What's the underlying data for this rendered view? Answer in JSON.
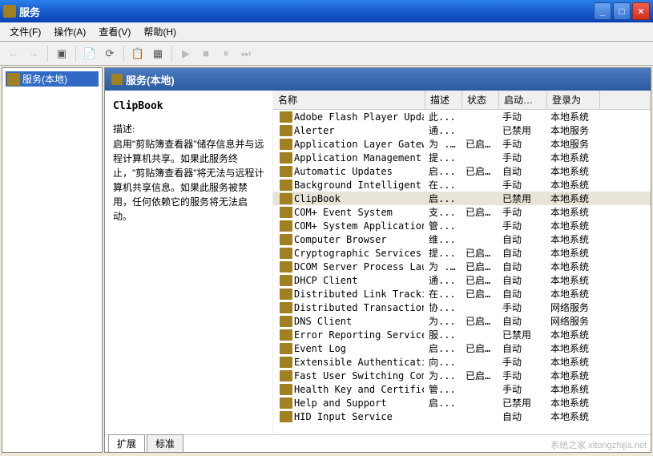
{
  "window": {
    "title": "服务"
  },
  "menu": {
    "file": "文件(F)",
    "action": "操作(A)",
    "view": "查看(V)",
    "help": "帮助(H)"
  },
  "tree": {
    "root": "服务(本地)"
  },
  "panel": {
    "header": "服务(本地)"
  },
  "detail": {
    "name": "ClipBook",
    "desc_label": "描述:",
    "desc_text": "启用\"剪贴簿查看器\"储存信息并与远程计算机共享。如果此服务终止，\"剪贴簿查看器\"将无法与远程计算机共享信息。如果此服务被禁用，任何依赖它的服务将无法启动。"
  },
  "columns": {
    "name": "名称",
    "desc": "描述",
    "state": "状态",
    "start": "启动类型",
    "logon": "登录为"
  },
  "tabs": {
    "ext": "扩展",
    "std": "标准"
  },
  "services": [
    {
      "name": "Adobe Flash Player Updat...",
      "desc": "此...",
      "state": "",
      "start": "手动",
      "logon": "本地系统"
    },
    {
      "name": "Alerter",
      "desc": "通...",
      "state": "",
      "start": "已禁用",
      "logon": "本地服务"
    },
    {
      "name": "Application Layer Gatewa...",
      "desc": "为 ...",
      "state": "已启动",
      "start": "手动",
      "logon": "本地服务"
    },
    {
      "name": "Application Management",
      "desc": "提...",
      "state": "",
      "start": "手动",
      "logon": "本地系统"
    },
    {
      "name": "Automatic Updates",
      "desc": "启...",
      "state": "已启动",
      "start": "自动",
      "logon": "本地系统"
    },
    {
      "name": "Background Intelligent T...",
      "desc": "在...",
      "state": "",
      "start": "手动",
      "logon": "本地系统"
    },
    {
      "name": "ClipBook",
      "desc": "启...",
      "state": "",
      "start": "已禁用",
      "logon": "本地系统",
      "selected": true
    },
    {
      "name": "COM+ Event System",
      "desc": "支...",
      "state": "已启动",
      "start": "手动",
      "logon": "本地系统"
    },
    {
      "name": "COM+ System Application",
      "desc": "管...",
      "state": "",
      "start": "手动",
      "logon": "本地系统"
    },
    {
      "name": "Computer Browser",
      "desc": "维...",
      "state": "",
      "start": "自动",
      "logon": "本地系统"
    },
    {
      "name": "Cryptographic Services",
      "desc": "提...",
      "state": "已启动",
      "start": "自动",
      "logon": "本地系统"
    },
    {
      "name": "DCOM Server Process Laun...",
      "desc": "为 ...",
      "state": "已启动",
      "start": "自动",
      "logon": "本地系统"
    },
    {
      "name": "DHCP Client",
      "desc": "通...",
      "state": "已启动",
      "start": "自动",
      "logon": "本地系统"
    },
    {
      "name": "Distributed Link Trackin...",
      "desc": "在...",
      "state": "已启动",
      "start": "自动",
      "logon": "本地系统"
    },
    {
      "name": "Distributed Transaction ...",
      "desc": "协...",
      "state": "",
      "start": "手动",
      "logon": "网络服务"
    },
    {
      "name": "DNS Client",
      "desc": "为...",
      "state": "已启动",
      "start": "自动",
      "logon": "网络服务"
    },
    {
      "name": "Error Reporting Service",
      "desc": "服...",
      "state": "",
      "start": "已禁用",
      "logon": "本地系统"
    },
    {
      "name": "Event Log",
      "desc": "启...",
      "state": "已启动",
      "start": "自动",
      "logon": "本地系统"
    },
    {
      "name": "Extensible Authenticatio...",
      "desc": "向...",
      "state": "",
      "start": "手动",
      "logon": "本地系统"
    },
    {
      "name": "Fast User Switching Comp...",
      "desc": "为...",
      "state": "已启动",
      "start": "手动",
      "logon": "本地系统"
    },
    {
      "name": "Health Key and Certifica...",
      "desc": "管...",
      "state": "",
      "start": "手动",
      "logon": "本地系统"
    },
    {
      "name": "Help and Support",
      "desc": "启...",
      "state": "",
      "start": "已禁用",
      "logon": "本地系统"
    },
    {
      "name": "HID Input Service",
      "desc": "",
      "state": "",
      "start": "自动",
      "logon": "本地系统"
    }
  ],
  "watermark": "系统之家 xitongzhijia.net"
}
